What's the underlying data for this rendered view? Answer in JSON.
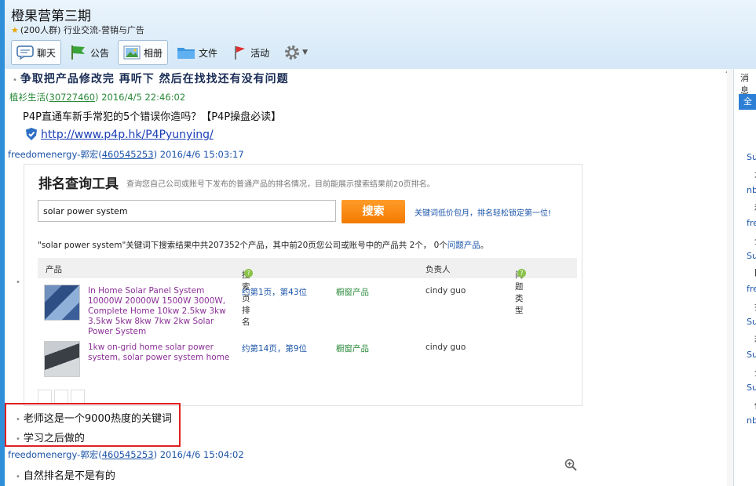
{
  "header": {
    "group_name": "橙果营第三期",
    "member_count": "(200人群)",
    "category": "行业交流-营销与广告"
  },
  "tabs": [
    {
      "label": "聊天",
      "icon": "chat-icon"
    },
    {
      "label": "公告",
      "icon": "flag-icon"
    },
    {
      "label": "相册",
      "icon": "photo-icon"
    },
    {
      "label": "文件",
      "icon": "folder-icon"
    },
    {
      "label": "活动",
      "icon": "pin-flag-icon"
    },
    {
      "label": "",
      "icon": "gear-icon"
    }
  ],
  "messages": {
    "m1_text": "争取把产品修改完 再听下 然后在找找还有没有问题",
    "m2_sender": "植衫生活(",
    "m2_qq": "30727460",
    "m2_time": ") 2016/4/5 22:46:02",
    "m2_text": "P4P直通车新手常犯的5个错误你造吗？【P4P操盘必读】",
    "m2_link": "http://www.p4p.hk/P4Pyunying/",
    "m3_sender": "freedomenergy-郭宏(",
    "m3_qq": "460545253",
    "m3_time": ") 2016/4/6 15:03:17",
    "m4_text": "老师这是一个9000热度的关键词",
    "m5_text": "学习之后做的",
    "m6_sender": "freedomenergy-郭宏(",
    "m6_qq": "460545253",
    "m6_time": ") 2016/4/6 15:04:02",
    "m6_text": "自然排名是不是有的"
  },
  "screenshot": {
    "title": "排名查询工具",
    "desc": "查询您自己公司或账号下发布的普通产品的排名情况，目前能展示搜索结果前20页排名。",
    "search_value": "solar power system",
    "search_button": "搜索",
    "promo": "关键词低价包月，排名轻松锁定第一位!",
    "result_prefix": "\"solar power system\"关键词下搜索结果中共207352个产品，其中前20页您公司或账号中的产品共 2个， 0个",
    "result_link": "问题产品",
    "result_suffix": "。",
    "columns": {
      "product": "产品",
      "rank": "搜索页排名",
      "owner": "负责人",
      "issue": "问题类型"
    },
    "rows": [
      {
        "name": "In Home Solar Panel System 10000W 20000W 1500W 3000W, Complete Home 10kw 2.5kw 3kw 3.5kw 5kw 8kw 7kw 2kw Solar Power System",
        "rank": "约第1页，第43位",
        "category": "橱窗产品",
        "owner": "cindy guo"
      },
      {
        "name": "1kw on-grid home solar power system, solar power system home",
        "rank": "约第14页，第9位",
        "category": "橱窗产品",
        "owner": "cindy guo"
      }
    ]
  },
  "right_panel": {
    "title": "消息",
    "button": "全",
    "items": [
      "Su",
      "才",
      "nb",
      "利",
      "fre",
      "全",
      "Su",
      "[",
      "fre",
      "排",
      "Su",
      "利",
      "Su",
      "全",
      "Su",
      "你",
      "nb"
    ]
  },
  "colors": {
    "accent": "#2f8fd8",
    "highlight_box": "#e02020",
    "search_button": "#f47a00"
  }
}
